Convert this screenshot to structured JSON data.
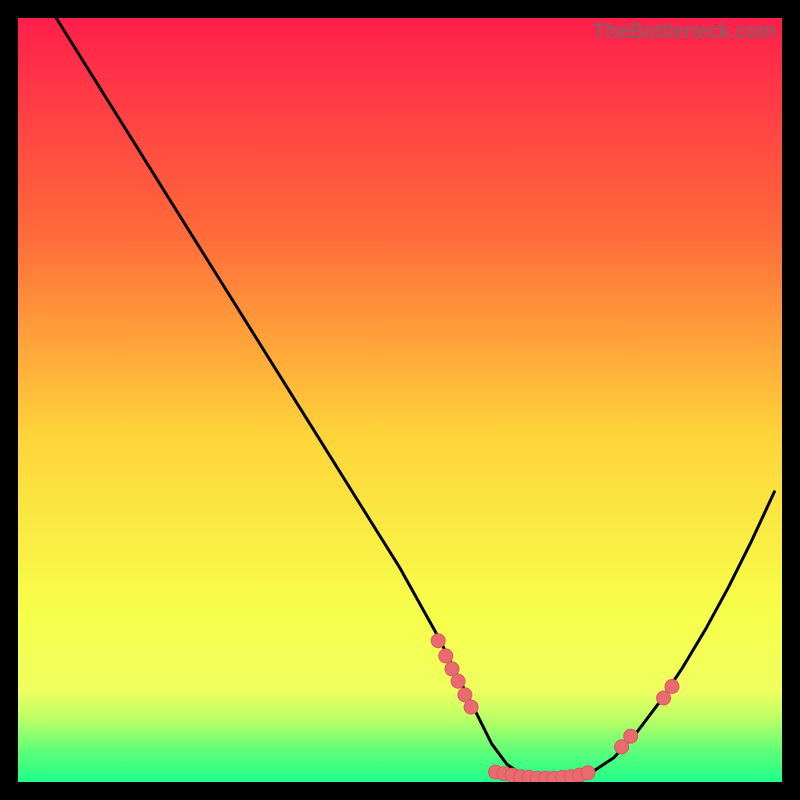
{
  "watermark": "TheBottleneck.com",
  "colors": {
    "gradient_top": "#ff1f4b",
    "gradient_mid1": "#ff6a3a",
    "gradient_mid2": "#ffd53a",
    "gradient_mid3": "#f6ff4a",
    "gradient_bottom_yellow": "#f0ff60",
    "gradient_green1": "#b8ff66",
    "gradient_green2": "#5dff7a",
    "gradient_green3": "#1fff8a",
    "curve": "#000000",
    "dot": "#e96a6f",
    "dot_stroke": "#d85a60"
  },
  "chart_data": {
    "type": "line",
    "title": "",
    "xlabel": "",
    "ylabel": "",
    "xlim": [
      0,
      100
    ],
    "ylim": [
      0,
      100
    ],
    "series": [
      {
        "name": "bottleneck-curve",
        "x": [
          5,
          10,
          15,
          20,
          25,
          30,
          35,
          40,
          45,
          50,
          55,
          58,
          60,
          62,
          64,
          66,
          68,
          70,
          72,
          75,
          78,
          81,
          84,
          87,
          90,
          93,
          96,
          99
        ],
        "y": [
          100,
          92,
          84,
          76,
          68,
          60,
          52,
          44,
          36,
          28,
          19,
          13,
          9,
          5,
          2.3,
          1.0,
          0.5,
          0.5,
          0.6,
          1.2,
          3.2,
          6.5,
          10.5,
          15,
          20,
          25.5,
          31.5,
          38
        ]
      }
    ],
    "scatter": [
      {
        "name": "left-cluster",
        "points": [
          {
            "x": 55.0,
            "y": 18.5
          },
          {
            "x": 56.0,
            "y": 16.5
          },
          {
            "x": 56.8,
            "y": 14.8
          },
          {
            "x": 57.6,
            "y": 13.2
          },
          {
            "x": 58.5,
            "y": 11.4
          },
          {
            "x": 59.3,
            "y": 9.8
          }
        ]
      },
      {
        "name": "bottom-cluster",
        "points": [
          {
            "x": 62.5,
            "y": 1.3
          },
          {
            "x": 63.6,
            "y": 1.1
          },
          {
            "x": 64.7,
            "y": 0.9
          },
          {
            "x": 65.8,
            "y": 0.7
          },
          {
            "x": 66.9,
            "y": 0.6
          },
          {
            "x": 68.0,
            "y": 0.5
          },
          {
            "x": 69.1,
            "y": 0.5
          },
          {
            "x": 70.2,
            "y": 0.5
          },
          {
            "x": 71.3,
            "y": 0.6
          },
          {
            "x": 72.4,
            "y": 0.7
          },
          {
            "x": 73.5,
            "y": 0.9
          },
          {
            "x": 74.6,
            "y": 1.2
          }
        ]
      },
      {
        "name": "right-cluster",
        "points": [
          {
            "x": 79.0,
            "y": 4.6
          },
          {
            "x": 80.2,
            "y": 6.0
          },
          {
            "x": 84.5,
            "y": 11.0
          },
          {
            "x": 85.6,
            "y": 12.5
          }
        ]
      }
    ]
  }
}
